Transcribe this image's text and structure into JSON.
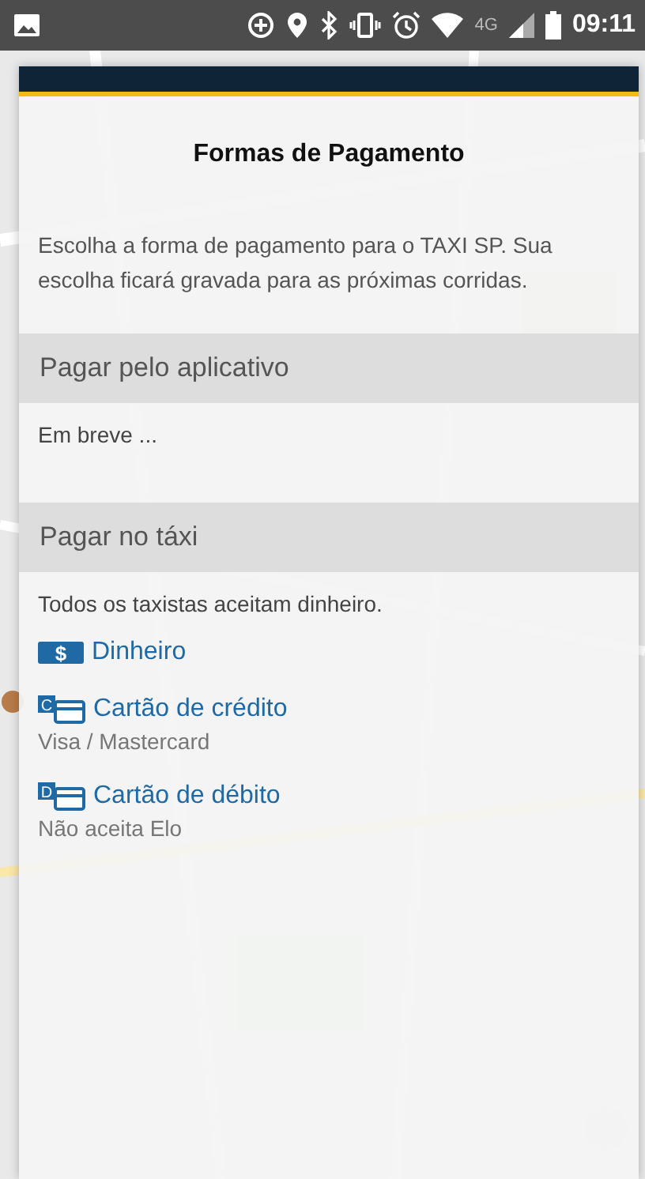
{
  "status_bar": {
    "network": "4G",
    "time": "09:11"
  },
  "dialog": {
    "title": "Formas de Pagamento",
    "description": "Escolha a forma de pagamento para o TAXI SP. Sua escolha ficará gravada para as próximas corridas.",
    "sections": [
      {
        "heading": "Pagar pelo aplicativo",
        "note": "Em breve ..."
      },
      {
        "heading": "Pagar no táxi",
        "note": "Todos os taxistas aceitam dinheiro.",
        "methods": [
          {
            "kind": "cash",
            "icon_letter": "$",
            "label": "Dinheiro"
          },
          {
            "kind": "card",
            "icon_letter": "C",
            "label": "Cartão de crédito",
            "detail": "Visa / Mastercard"
          },
          {
            "kind": "card",
            "icon_letter": "D",
            "label": "Cartão de débito",
            "detail": "Não aceita Elo"
          }
        ]
      }
    ]
  }
}
